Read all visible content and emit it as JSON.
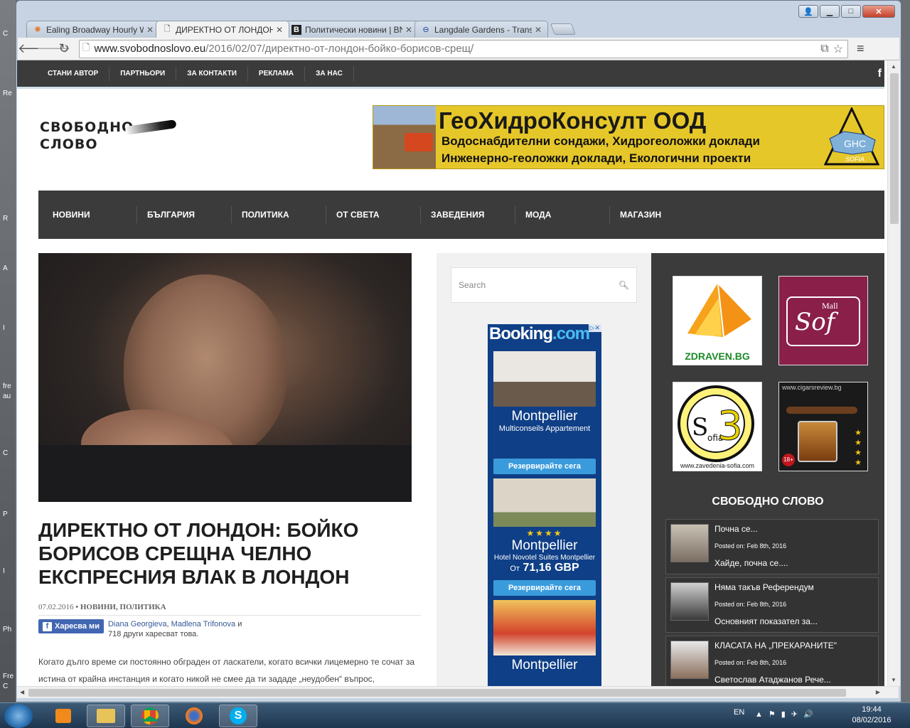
{
  "desktop": {
    "fragments": [
      "C",
      "Re",
      "R",
      "A",
      "I",
      "fre",
      "au",
      "C",
      "I",
      "P",
      "I",
      "Ph",
      "Fre",
      "C"
    ]
  },
  "browser": {
    "tabs": [
      {
        "title": "Ealing Broadway Hourly W",
        "icon": "weather-sun-icon",
        "active": false
      },
      {
        "title": "ДИРЕКТНО ОТ ЛОНДОН:",
        "icon": "page-icon",
        "active": true
      },
      {
        "title": "Политически новини | BN",
        "icon": "b-logo-icon",
        "active": false
      },
      {
        "title": "Langdale Gardens - Transp",
        "icon": "tfl-roundel-icon",
        "active": false
      }
    ],
    "url_host": "www.svobodnoslovo.eu",
    "url_path": "/2016/02/07/директно-от-лондон-бойко-борисов-срещ/"
  },
  "site": {
    "top_links": [
      "СТАНИ АВТОР",
      "ПАРТНЬОРИ",
      "ЗА КОНТАКТИ",
      "РЕКЛАМА",
      "ЗА НАС"
    ],
    "social": "f",
    "logo_line1": "СВОБОДНО",
    "logo_line2": "СЛОВО",
    "banner": {
      "title": "ГеоХидроКонсулт ООД",
      "line1": "Водоснабдителни сондажи, Хидрогеоложки доклади",
      "line2": "Инженерно-геоложки доклади, Екологични проекти",
      "badge": "GHC",
      "badge_sub": "SOFIA"
    },
    "main_nav": [
      "НОВИНИ",
      "БЪЛГАРИЯ",
      "ПОЛИТИКА",
      "ОТ СВЕТА",
      "ЗАВЕДЕНИЯ",
      "МОДА",
      "МАГАЗИН"
    ]
  },
  "article": {
    "title": "Директно от Лондон: Бойко Борисов срещна челно експресния влак в Лондон",
    "date": "07.02.2016",
    "bullet": "•",
    "categories": "НОВИНИ, ПОЛИТИКА",
    "fb_like_label": "Харесва ми",
    "fb_name1": "Diana Georgieva",
    "fb_sep": ", ",
    "fb_name2": "Madlena Trifonova",
    "fb_and": " и",
    "fb_others": "718 други харесват това.",
    "body": "Когато дълго време си постоянно обграден от ласкатели, когато всички лицемерно те сочат за истина от крайна инстанция и когато никой не смее да ти зададе „неудобен“ въпрос,"
  },
  "search": {
    "placeholder": "Search"
  },
  "booking_ad": {
    "brand": "Booking",
    "brand_tld": ".com",
    "ad_badge": "▷✕",
    "cards": [
      {
        "city": "Montpellier",
        "sub": "Multiconseils Appartement",
        "stars": "",
        "price_prefix": "",
        "price": "",
        "cta": "Резервирайте сега"
      },
      {
        "city": "Montpellier",
        "sub": "Hotel Novotel Suites Montpellier",
        "stars": "★★★★",
        "price_prefix": "От",
        "price": "71,16 GBP",
        "cta": "Резервирайте сега"
      },
      {
        "city": "Montpellier",
        "sub": "",
        "stars": "",
        "price_prefix": "",
        "price": "",
        "cta": ""
      }
    ]
  },
  "partners": [
    {
      "name": "ZDRAVEN.BG"
    },
    {
      "name": "Sof",
      "tag": "Mall"
    },
    {
      "name": "www.zavedenia-sofia.com",
      "mark": "S",
      "sub": "ofia",
      "num": "3"
    },
    {
      "name": "www.cigarsreview.bg"
    }
  ],
  "widget": {
    "title": "СВОБОДНО СЛОВО",
    "posts": [
      {
        "title": "Почна се...",
        "date": "Posted on: Feb 8th, 2016",
        "excerpt": "Хайде, почна се...."
      },
      {
        "title": "Няма такъв Референдум",
        "date": "Posted on: Feb 8th, 2016",
        "excerpt": "Основният показател за..."
      },
      {
        "title": "КЛАСАТА НА „ПРЕКАРАНИТЕ\"",
        "date": "Posted on: Feb 8th, 2016",
        "excerpt": "Светослав Атаджанов Рече..."
      }
    ]
  },
  "taskbar": {
    "lang": "EN",
    "time": "19:44",
    "date": "08/02/2016"
  }
}
